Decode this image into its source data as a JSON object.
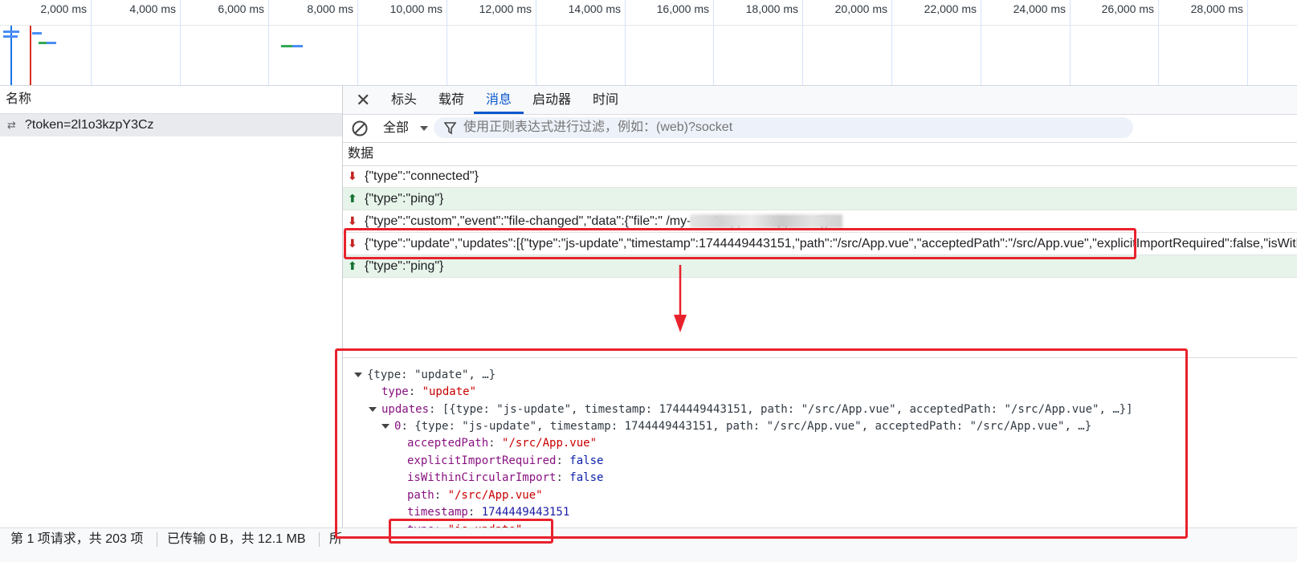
{
  "timeline": {
    "ticks": [
      "2,000 ms",
      "4,000 ms",
      "6,000 ms",
      "8,000 ms",
      "10,000 ms",
      "12,000 ms",
      "14,000 ms",
      "16,000 ms",
      "18,000 ms",
      "20,000 ms",
      "22,000 ms",
      "24,000 ms",
      "26,000 ms",
      "28,000 ms"
    ]
  },
  "left_pane": {
    "column_header": "名称",
    "requests": [
      {
        "name": "?token=2l1o3kzpY3Cz"
      }
    ]
  },
  "right_pane": {
    "tabs": [
      "标头",
      "载荷",
      "消息",
      "启动器",
      "时间"
    ],
    "active_tab": "消息",
    "filter": {
      "type_label": "全部",
      "placeholder": "使用正则表达式进行过滤，例如：(web)?socket"
    },
    "data_header": "数据",
    "messages": [
      {
        "direction": "received",
        "text": "{\"type\":\"connected\"}"
      },
      {
        "direction": "sent",
        "text": "{\"type\":\"ping\"}"
      },
      {
        "direction": "received",
        "text": "{\"type\":\"custom\",\"event\":\"file-changed\",\"data\":{\"file\":\"                              /my-vue3-app/src/App.vue\"}}"
      },
      {
        "direction": "received",
        "text": "{\"type\":\"update\",\"updates\":[{\"type\":\"js-update\",\"timestamp\":1744449443151,\"path\":\"/src/App.vue\",\"acceptedPath\":\"/src/App.vue\",\"explicitImportRequired\":false,\"isWithinCircularImport\":false}]}"
      },
      {
        "direction": "sent",
        "text": "{\"type\":\"ping\"}"
      }
    ]
  },
  "detail": {
    "root_summary": "{type: \"update\", …}",
    "type_key": "type",
    "type_value": "\"update\"",
    "updates_key": "updates",
    "updates_summary": "[{type: \"js-update\", timestamp: 1744449443151, path: \"/src/App.vue\", acceptedPath: \"/src/App.vue\", …}]",
    "item_index": "0",
    "item_summary": "{type: \"js-update\", timestamp: 1744449443151, path: \"/src/App.vue\", acceptedPath: \"/src/App.vue\", …}",
    "fields": [
      {
        "key": "acceptedPath",
        "value": "\"/src/App.vue\"",
        "kind": "str"
      },
      {
        "key": "explicitImportRequired",
        "value": "false",
        "kind": "bool"
      },
      {
        "key": "isWithinCircularImport",
        "value": "false",
        "kind": "bool"
      },
      {
        "key": "path",
        "value": "\"/src/App.vue\"",
        "kind": "str"
      },
      {
        "key": "timestamp",
        "value": "1744449443151",
        "kind": "num"
      },
      {
        "key": "type",
        "value": "\"js-update\"",
        "kind": "str"
      }
    ]
  },
  "status_bar": {
    "requests": "第 1 项请求，共 203 项",
    "transferred": "已传输 0 B，共 12.1 MB",
    "more": "所"
  },
  "colors": {
    "accent": "#0b57d0",
    "annotation_red": "#e8222d",
    "sent_row_bg": "#e6f4ea"
  }
}
